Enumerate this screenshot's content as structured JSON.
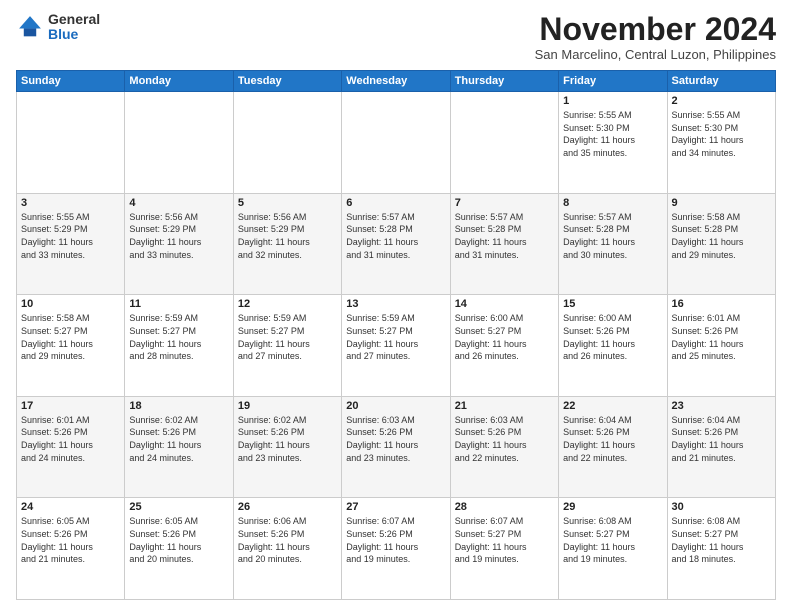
{
  "logo": {
    "general": "General",
    "blue": "Blue"
  },
  "header": {
    "month": "November 2024",
    "location": "San Marcelino, Central Luzon, Philippines"
  },
  "weekdays": [
    "Sunday",
    "Monday",
    "Tuesday",
    "Wednesday",
    "Thursday",
    "Friday",
    "Saturday"
  ],
  "weeks": [
    [
      {
        "day": "",
        "info": ""
      },
      {
        "day": "",
        "info": ""
      },
      {
        "day": "",
        "info": ""
      },
      {
        "day": "",
        "info": ""
      },
      {
        "day": "",
        "info": ""
      },
      {
        "day": "1",
        "info": "Sunrise: 5:55 AM\nSunset: 5:30 PM\nDaylight: 11 hours\nand 35 minutes."
      },
      {
        "day": "2",
        "info": "Sunrise: 5:55 AM\nSunset: 5:30 PM\nDaylight: 11 hours\nand 34 minutes."
      }
    ],
    [
      {
        "day": "3",
        "info": "Sunrise: 5:55 AM\nSunset: 5:29 PM\nDaylight: 11 hours\nand 33 minutes."
      },
      {
        "day": "4",
        "info": "Sunrise: 5:56 AM\nSunset: 5:29 PM\nDaylight: 11 hours\nand 33 minutes."
      },
      {
        "day": "5",
        "info": "Sunrise: 5:56 AM\nSunset: 5:29 PM\nDaylight: 11 hours\nand 32 minutes."
      },
      {
        "day": "6",
        "info": "Sunrise: 5:57 AM\nSunset: 5:28 PM\nDaylight: 11 hours\nand 31 minutes."
      },
      {
        "day": "7",
        "info": "Sunrise: 5:57 AM\nSunset: 5:28 PM\nDaylight: 11 hours\nand 31 minutes."
      },
      {
        "day": "8",
        "info": "Sunrise: 5:57 AM\nSunset: 5:28 PM\nDaylight: 11 hours\nand 30 minutes."
      },
      {
        "day": "9",
        "info": "Sunrise: 5:58 AM\nSunset: 5:28 PM\nDaylight: 11 hours\nand 29 minutes."
      }
    ],
    [
      {
        "day": "10",
        "info": "Sunrise: 5:58 AM\nSunset: 5:27 PM\nDaylight: 11 hours\nand 29 minutes."
      },
      {
        "day": "11",
        "info": "Sunrise: 5:59 AM\nSunset: 5:27 PM\nDaylight: 11 hours\nand 28 minutes."
      },
      {
        "day": "12",
        "info": "Sunrise: 5:59 AM\nSunset: 5:27 PM\nDaylight: 11 hours\nand 27 minutes."
      },
      {
        "day": "13",
        "info": "Sunrise: 5:59 AM\nSunset: 5:27 PM\nDaylight: 11 hours\nand 27 minutes."
      },
      {
        "day": "14",
        "info": "Sunrise: 6:00 AM\nSunset: 5:27 PM\nDaylight: 11 hours\nand 26 minutes."
      },
      {
        "day": "15",
        "info": "Sunrise: 6:00 AM\nSunset: 5:26 PM\nDaylight: 11 hours\nand 26 minutes."
      },
      {
        "day": "16",
        "info": "Sunrise: 6:01 AM\nSunset: 5:26 PM\nDaylight: 11 hours\nand 25 minutes."
      }
    ],
    [
      {
        "day": "17",
        "info": "Sunrise: 6:01 AM\nSunset: 5:26 PM\nDaylight: 11 hours\nand 24 minutes."
      },
      {
        "day": "18",
        "info": "Sunrise: 6:02 AM\nSunset: 5:26 PM\nDaylight: 11 hours\nand 24 minutes."
      },
      {
        "day": "19",
        "info": "Sunrise: 6:02 AM\nSunset: 5:26 PM\nDaylight: 11 hours\nand 23 minutes."
      },
      {
        "day": "20",
        "info": "Sunrise: 6:03 AM\nSunset: 5:26 PM\nDaylight: 11 hours\nand 23 minutes."
      },
      {
        "day": "21",
        "info": "Sunrise: 6:03 AM\nSunset: 5:26 PM\nDaylight: 11 hours\nand 22 minutes."
      },
      {
        "day": "22",
        "info": "Sunrise: 6:04 AM\nSunset: 5:26 PM\nDaylight: 11 hours\nand 22 minutes."
      },
      {
        "day": "23",
        "info": "Sunrise: 6:04 AM\nSunset: 5:26 PM\nDaylight: 11 hours\nand 21 minutes."
      }
    ],
    [
      {
        "day": "24",
        "info": "Sunrise: 6:05 AM\nSunset: 5:26 PM\nDaylight: 11 hours\nand 21 minutes."
      },
      {
        "day": "25",
        "info": "Sunrise: 6:05 AM\nSunset: 5:26 PM\nDaylight: 11 hours\nand 20 minutes."
      },
      {
        "day": "26",
        "info": "Sunrise: 6:06 AM\nSunset: 5:26 PM\nDaylight: 11 hours\nand 20 minutes."
      },
      {
        "day": "27",
        "info": "Sunrise: 6:07 AM\nSunset: 5:26 PM\nDaylight: 11 hours\nand 19 minutes."
      },
      {
        "day": "28",
        "info": "Sunrise: 6:07 AM\nSunset: 5:27 PM\nDaylight: 11 hours\nand 19 minutes."
      },
      {
        "day": "29",
        "info": "Sunrise: 6:08 AM\nSunset: 5:27 PM\nDaylight: 11 hours\nand 19 minutes."
      },
      {
        "day": "30",
        "info": "Sunrise: 6:08 AM\nSunset: 5:27 PM\nDaylight: 11 hours\nand 18 minutes."
      }
    ]
  ]
}
